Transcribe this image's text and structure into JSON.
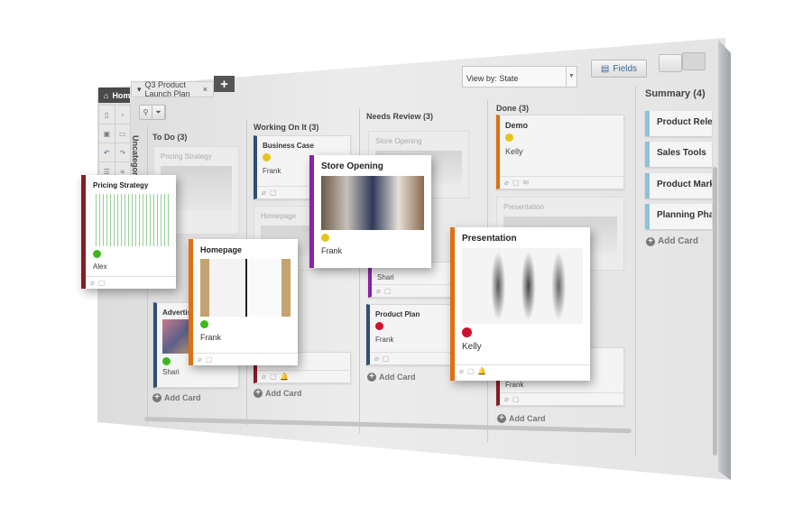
{
  "tabs": {
    "home": "Home",
    "document": "Q3 Product Launch Plan",
    "close": "×",
    "add": "+"
  },
  "toolbar": {
    "view_by": "View by: State",
    "fields": "Fields"
  },
  "sidebar": {
    "uncategorized": "Uncategorized"
  },
  "columns": [
    {
      "title": "To Do (3)",
      "add": "Add Card"
    },
    {
      "title": "Working On It (3)",
      "add": "Add Card"
    },
    {
      "title": "Needs Review (3)",
      "add": "Add Card"
    },
    {
      "title": "Done (3)",
      "add": "Add Card"
    }
  ],
  "ghost_cards": {
    "pricing": "Pricing Strategy",
    "homepage": "Homepage",
    "store": "Store Opening",
    "presentation": "Presentation"
  },
  "cards": {
    "business_case": {
      "title": "Business Case",
      "owner": "Frank",
      "status": "#e8c419"
    },
    "advertising": {
      "title": "Advertising",
      "owner": "Shari",
      "status": "#3cb81c"
    },
    "shari": {
      "owner": "Shari"
    },
    "product_plan": {
      "title": "Product Plan",
      "owner": "Frank",
      "status": "#d0102c"
    },
    "demo": {
      "title": "Demo",
      "owner": "Kelly",
      "status": "#e8c419"
    },
    "done_hidden": {
      "owner": "Frank"
    }
  },
  "floating_cards": {
    "pricing": {
      "title": "Pricing Strategy",
      "owner": "Alex",
      "status": "#3cb81c",
      "color": "#8a1c24"
    },
    "homepage": {
      "title": "Homepage",
      "owner": "Frank",
      "status": "#3cb81c",
      "color": "#e07010"
    },
    "store": {
      "title": "Store Opening",
      "owner": "Frank",
      "status": "#e8c419",
      "color": "#8a22a8"
    },
    "presentation": {
      "title": "Presentation",
      "owner": "Kelly",
      "status": "#d0102c",
      "color": "#e07010"
    }
  },
  "summary": {
    "title": "Summary (4)",
    "items": [
      "Product Release",
      "Sales Tools",
      "Product Marketing",
      "Planning Phase"
    ],
    "add": "Add Card"
  }
}
